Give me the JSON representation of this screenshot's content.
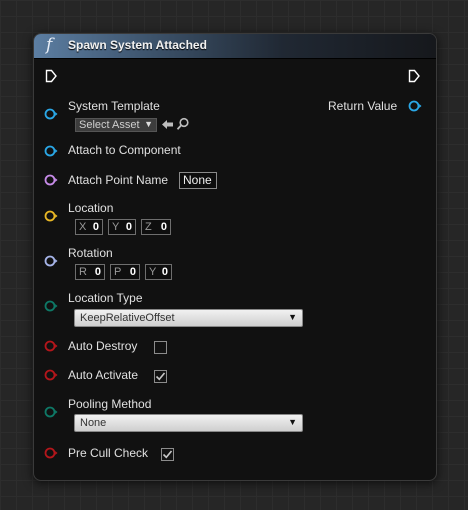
{
  "node": {
    "title": "Spawn System Attached",
    "func_symbol": "f",
    "header_color": "#5c7ea2"
  },
  "pins": {
    "system_template": {
      "label": "System Template",
      "asset_placeholder": "Select Asset",
      "color": "#2aa7e6"
    },
    "return_value": {
      "label": "Return Value",
      "color": "#2aa7e6"
    },
    "attach_to_component": {
      "label": "Attach to Component",
      "color": "#2aa7e6"
    },
    "attach_point_name": {
      "label": "Attach Point Name",
      "value": "None",
      "color": "#c68be8"
    },
    "location": {
      "label": "Location",
      "color": "#e8b725",
      "x_label": "X",
      "x": "0",
      "y_label": "Y",
      "y": "0",
      "z_label": "Z",
      "z": "0"
    },
    "rotation": {
      "label": "Rotation",
      "color": "#a6b4e8",
      "r_label": "R",
      "r": "0",
      "p_label": "P",
      "p": "0",
      "yaw_label": "Y",
      "yaw": "0"
    },
    "location_type": {
      "label": "Location Type",
      "value": "KeepRelativeOffset",
      "color": "#0e7866"
    },
    "auto_destroy": {
      "label": "Auto Destroy",
      "checked": false,
      "color": "#b4161b"
    },
    "auto_activate": {
      "label": "Auto Activate",
      "checked": true,
      "color": "#b4161b"
    },
    "pooling_method": {
      "label": "Pooling Method",
      "value": "None",
      "color": "#0e7866"
    },
    "pre_cull_check": {
      "label": "Pre Cull Check",
      "checked": true,
      "color": "#b4161b"
    }
  },
  "icons": {
    "exec_in": "exec-arrow",
    "exec_out": "exec-arrow",
    "use_selected": "left-arrow-icon",
    "browse": "magnifier-icon"
  }
}
